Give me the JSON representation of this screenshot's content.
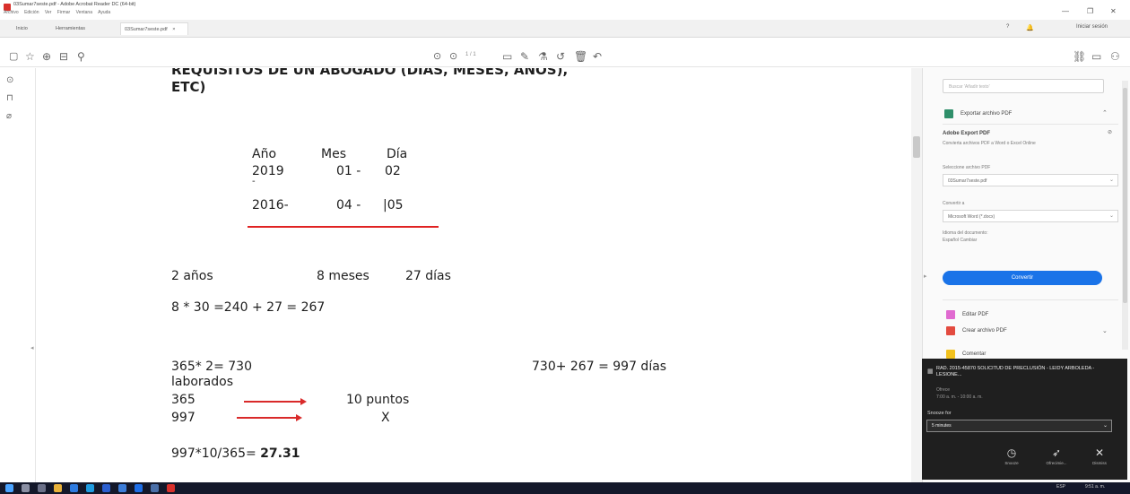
{
  "window": {
    "title": "03Sumar7seste.pdf - Adobe Acrobat Reader DC (64-bit)",
    "menu": [
      "Archivo",
      "Edición",
      "Ver",
      "Firmar",
      "Ventana",
      "Ayuda"
    ],
    "controls": {
      "minimize": "—",
      "maximize": "❐",
      "close": "✕"
    }
  },
  "tabs": {
    "home": "Inicio",
    "tools": "Herramientas",
    "document": "03Sumar7seste.pdf",
    "help": "?",
    "notifications": "🔔",
    "signin": "Iniciar sesión"
  },
  "toolbar": {
    "page_indicator": "1 / 1",
    "zoom": ""
  },
  "document": {
    "heading_line1": "REQUISITOS DE UN ABOGADO (DIAS, MESES, AÑOS),",
    "heading_line2": "ETC)",
    "col_year": "Año",
    "col_month": "Mes",
    "col_day": "Día",
    "row1_year": "2019",
    "row1_month": "01 -",
    "row1_day": "02",
    "row1_dash": "-",
    "row2_year": "2016-",
    "row2_month": "04 -",
    "row2_day": "|05",
    "result_years": "2 años",
    "result_months": "8 meses",
    "result_days": "27 días",
    "calc1": "8 * 30 =240 + 27 = 267",
    "calc2": "365* 2= 730",
    "calc3": "730+ 267 = 997 días",
    "calc4": "laborados",
    "rule_a_left": "365",
    "rule_a_right": "10 puntos",
    "rule_b_left": "997",
    "rule_b_right": "X",
    "final_expr": "997*10/365=",
    "final_value": "27.31"
  },
  "right_panel": {
    "search_placeholder": "Buscar 'Añadir texto'",
    "export_title": "Exportar archivo PDF",
    "export_service": "Adobe Export PDF",
    "export_desc": "Convierta archivos PDF a Word o Excel Online",
    "select_file_label": "Seleccione archivo PDF",
    "select_file_value": "03Sumar7seste.pdf",
    "convert_to_label": "Convertir a",
    "convert_to_value": "Microsoft Word (*.docx)",
    "doc_language_label": "Idioma del documento:",
    "doc_language_value": "Español  Cambiar",
    "convert_button": "Convertir",
    "tool1": "Editar PDF",
    "tool2": "Crear archivo PDF",
    "tool3": "Comentar"
  },
  "notification": {
    "title": "RAD. 2015-45870 SOLICITUD DE PRECLUSIÓN - LEIDY ARBOLEDA - LESIONE...",
    "sub1": "Ofrece",
    "sub2": "7:00 a. m. - 10:00 a. m.",
    "snooze_label": "Snooze for",
    "snooze_value": "5 minutes",
    "btn_open": "Snooze",
    "btn_join": "Ofrecimie...",
    "btn_dismiss": "Dismiss"
  },
  "taskbar": {
    "clock": "9:51 a. m.",
    "lang": "ESP"
  },
  "colors": {
    "accent_red": "#e02222",
    "acrobat_red": "#d9302b",
    "convert_blue": "#1a73e8",
    "notification_bg": "#1f1f1f",
    "taskbar_bg": "#14182a"
  }
}
